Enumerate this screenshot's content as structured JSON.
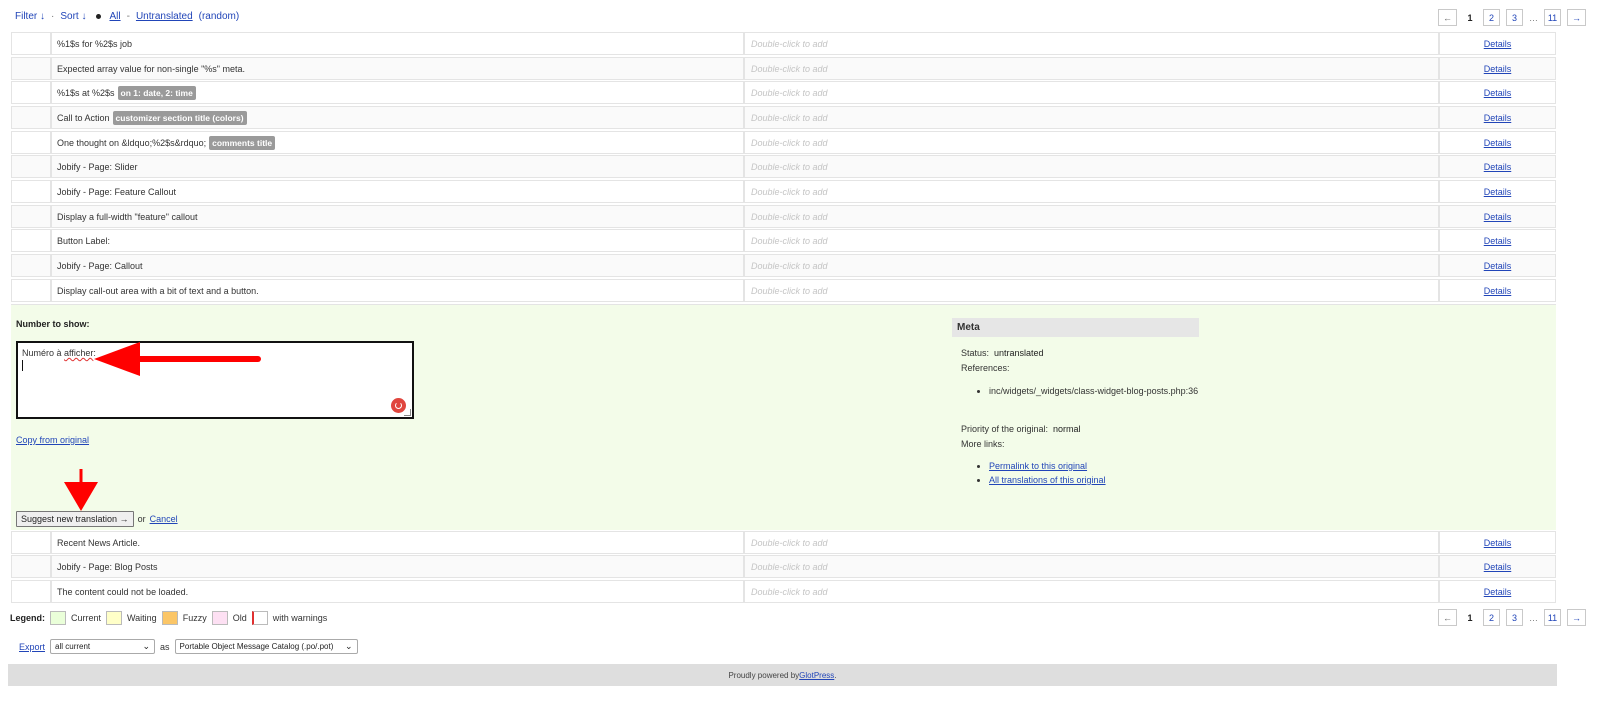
{
  "filter_bar": {
    "filter": "Filter ↓",
    "dot_sep": "·",
    "sort": "Sort ↓",
    "all": "All",
    "dash": "-",
    "untranslated": "Untranslated",
    "random": "(random)"
  },
  "pagination": {
    "prev": "←",
    "current": "1",
    "page2": "2",
    "page3": "3",
    "ellipsis": "…",
    "last": "11",
    "next": "→"
  },
  "placeholder": "Double-click to add",
  "details_label": "Details",
  "rows_top": [
    {
      "text": "%1$s for %2$s job",
      "tag": ""
    },
    {
      "text": "Expected array value for non-single \"%s\" meta.",
      "tag": ""
    },
    {
      "text": "%1$s at %2$s",
      "tag": "on 1: date, 2: time"
    },
    {
      "text": "Call to Action",
      "tag": "customizer section title (colors)"
    },
    {
      "text": "One thought on &ldquo;%2$s&rdquo;",
      "tag": "comments title"
    },
    {
      "text": "Jobify - Page: Slider",
      "tag": ""
    },
    {
      "text": "Jobify - Page: Feature Callout",
      "tag": ""
    },
    {
      "text": "Display a full-width \"feature\" callout",
      "tag": ""
    },
    {
      "text": "Button Label:",
      "tag": ""
    },
    {
      "text": "Jobify - Page: Callout",
      "tag": ""
    },
    {
      "text": "Display call-out area with a bit of text and a button.",
      "tag": ""
    }
  ],
  "editor": {
    "original": "Number to show:",
    "translation_prefix": "Numéro à ",
    "translation_word": "afficher",
    "translation_suffix": ":",
    "copy_link": "Copy from original",
    "submit": "Suggest new translation →",
    "or": "or",
    "cancel": "Cancel"
  },
  "meta": {
    "title": "Meta",
    "status_label": "Status:",
    "status_value": "untranslated",
    "references_label": "References:",
    "reference": "inc/widgets/_widgets/class-widget-blog-posts.php:36",
    "priority_label": "Priority of the original:",
    "priority_value": "normal",
    "more_links_label": "More links:",
    "permalink": "Permalink to this original",
    "all_translations": "All translations of this original"
  },
  "rows_bottom": [
    {
      "text": "Recent News Article."
    },
    {
      "text": "Jobify - Page: Blog Posts"
    },
    {
      "text": "The content could not be loaded."
    }
  ],
  "legend": {
    "label": "Legend:",
    "items": [
      {
        "label": "Current",
        "color": "#eaffd9"
      },
      {
        "label": "Waiting",
        "color": "#ffffc8"
      },
      {
        "label": "Fuzzy",
        "color": "#fbc667"
      },
      {
        "label": "Old",
        "color": "#fde0f3"
      },
      {
        "label": "with warnings",
        "color": "#ffffff"
      }
    ]
  },
  "export": {
    "link": "Export",
    "selection": "all current",
    "as": "as",
    "format": "Portable Object Message Catalog (.po/.pot)"
  },
  "footer": {
    "prefix": "Proudly powered by ",
    "link": "GlotPress",
    "suffix": "."
  },
  "colors": {
    "link": "#2145b8",
    "editor_bg": "#f3fce9",
    "annotation_arrow": "#ff0000"
  }
}
